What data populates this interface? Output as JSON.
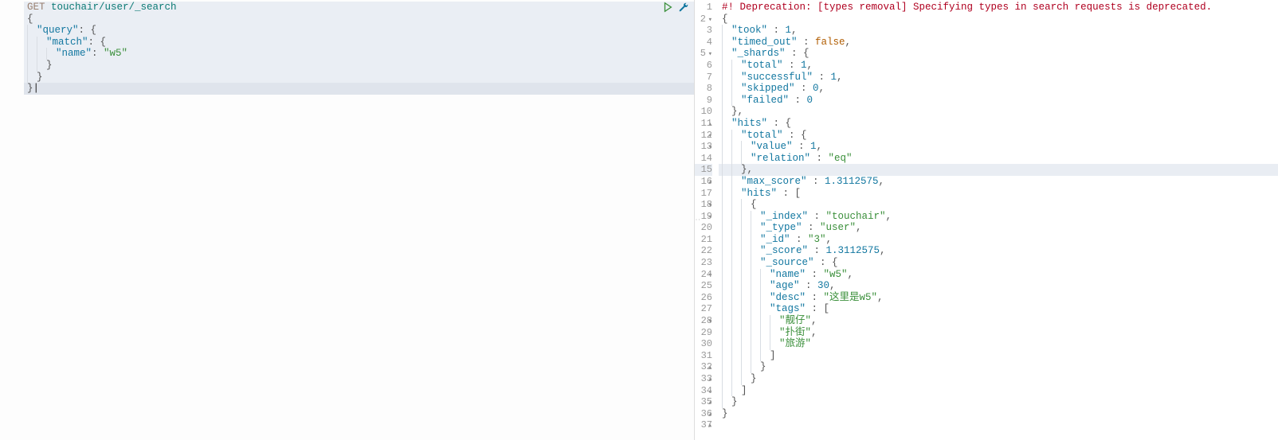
{
  "request": {
    "method": "GET",
    "path": "touchair/user/_search",
    "lines": [
      {
        "indent": 0,
        "text": "{"
      },
      {
        "indent": 1,
        "segs": [
          {
            "t": "key",
            "v": "\"query\""
          },
          {
            "t": "punct",
            "v": ": {"
          }
        ]
      },
      {
        "indent": 2,
        "segs": [
          {
            "t": "key",
            "v": "\"match\""
          },
          {
            "t": "punct",
            "v": ": {"
          }
        ]
      },
      {
        "indent": 3,
        "segs": [
          {
            "t": "key",
            "v": "\"name\""
          },
          {
            "t": "punct",
            "v": ": "
          },
          {
            "t": "str",
            "v": "\"w5\""
          }
        ]
      },
      {
        "indent": 2,
        "text": "}"
      },
      {
        "indent": 1,
        "text": "}"
      },
      {
        "indent": 0,
        "text": "}",
        "cursor": true
      }
    ]
  },
  "response": {
    "lines": [
      {
        "n": 1,
        "segs": [
          {
            "t": "err",
            "v": "#! Deprecation: [types removal] Specifying types in search requests is deprecated."
          }
        ]
      },
      {
        "n": 2,
        "fold": "▾",
        "segs": [
          {
            "t": "punct",
            "v": "{"
          }
        ]
      },
      {
        "n": 3,
        "indent": 1,
        "segs": [
          {
            "t": "key",
            "v": "\"took\""
          },
          {
            "t": "punct",
            "v": " : "
          },
          {
            "t": "num",
            "v": "1"
          },
          {
            "t": "punct",
            "v": ","
          }
        ]
      },
      {
        "n": 4,
        "indent": 1,
        "segs": [
          {
            "t": "key",
            "v": "\"timed_out\""
          },
          {
            "t": "punct",
            "v": " : "
          },
          {
            "t": "bool",
            "v": "false"
          },
          {
            "t": "punct",
            "v": ","
          }
        ]
      },
      {
        "n": 5,
        "fold": "▾",
        "indent": 1,
        "segs": [
          {
            "t": "key",
            "v": "\"_shards\""
          },
          {
            "t": "punct",
            "v": " : {"
          }
        ]
      },
      {
        "n": 6,
        "indent": 2,
        "segs": [
          {
            "t": "key",
            "v": "\"total\""
          },
          {
            "t": "punct",
            "v": " : "
          },
          {
            "t": "num",
            "v": "1"
          },
          {
            "t": "punct",
            "v": ","
          }
        ]
      },
      {
        "n": 7,
        "indent": 2,
        "segs": [
          {
            "t": "key",
            "v": "\"successful\""
          },
          {
            "t": "punct",
            "v": " : "
          },
          {
            "t": "num",
            "v": "1"
          },
          {
            "t": "punct",
            "v": ","
          }
        ]
      },
      {
        "n": 8,
        "indent": 2,
        "segs": [
          {
            "t": "key",
            "v": "\"skipped\""
          },
          {
            "t": "punct",
            "v": " : "
          },
          {
            "t": "num",
            "v": "0"
          },
          {
            "t": "punct",
            "v": ","
          }
        ]
      },
      {
        "n": 9,
        "indent": 2,
        "segs": [
          {
            "t": "key",
            "v": "\"failed\""
          },
          {
            "t": "punct",
            "v": " : "
          },
          {
            "t": "num",
            "v": "0"
          }
        ]
      },
      {
        "n": 10,
        "fold": "▴",
        "indent": 1,
        "segs": [
          {
            "t": "punct",
            "v": "},"
          }
        ]
      },
      {
        "n": 11,
        "fold": "▾",
        "indent": 1,
        "segs": [
          {
            "t": "key",
            "v": "\"hits\""
          },
          {
            "t": "punct",
            "v": " : {"
          }
        ]
      },
      {
        "n": 12,
        "fold": "▾",
        "indent": 2,
        "segs": [
          {
            "t": "key",
            "v": "\"total\""
          },
          {
            "t": "punct",
            "v": " : {"
          }
        ]
      },
      {
        "n": 13,
        "indent": 3,
        "segs": [
          {
            "t": "key",
            "v": "\"value\""
          },
          {
            "t": "punct",
            "v": " : "
          },
          {
            "t": "num",
            "v": "1"
          },
          {
            "t": "punct",
            "v": ","
          }
        ]
      },
      {
        "n": 14,
        "indent": 3,
        "segs": [
          {
            "t": "key",
            "v": "\"relation\""
          },
          {
            "t": "punct",
            "v": " : "
          },
          {
            "t": "str",
            "v": "\"eq\""
          }
        ]
      },
      {
        "n": 15,
        "fold": "▴",
        "indent": 2,
        "current": true,
        "segs": [
          {
            "t": "punct",
            "v": "},"
          }
        ]
      },
      {
        "n": 16,
        "indent": 2,
        "segs": [
          {
            "t": "key",
            "v": "\"max_score\""
          },
          {
            "t": "punct",
            "v": " : "
          },
          {
            "t": "num",
            "v": "1.3112575"
          },
          {
            "t": "punct",
            "v": ","
          }
        ]
      },
      {
        "n": 17,
        "fold": "▾",
        "indent": 2,
        "segs": [
          {
            "t": "key",
            "v": "\"hits\""
          },
          {
            "t": "punct",
            "v": " : ["
          }
        ]
      },
      {
        "n": 18,
        "fold": "▾",
        "indent": 3,
        "segs": [
          {
            "t": "punct",
            "v": "{"
          }
        ]
      },
      {
        "n": 19,
        "indent": 4,
        "segs": [
          {
            "t": "key",
            "v": "\"_index\""
          },
          {
            "t": "punct",
            "v": " : "
          },
          {
            "t": "str",
            "v": "\"touchair\""
          },
          {
            "t": "punct",
            "v": ","
          }
        ]
      },
      {
        "n": 20,
        "indent": 4,
        "segs": [
          {
            "t": "key",
            "v": "\"_type\""
          },
          {
            "t": "punct",
            "v": " : "
          },
          {
            "t": "str",
            "v": "\"user\""
          },
          {
            "t": "punct",
            "v": ","
          }
        ]
      },
      {
        "n": 21,
        "indent": 4,
        "segs": [
          {
            "t": "key",
            "v": "\"_id\""
          },
          {
            "t": "punct",
            "v": " : "
          },
          {
            "t": "str",
            "v": "\"3\""
          },
          {
            "t": "punct",
            "v": ","
          }
        ]
      },
      {
        "n": 22,
        "indent": 4,
        "segs": [
          {
            "t": "key",
            "v": "\"_score\""
          },
          {
            "t": "punct",
            "v": " : "
          },
          {
            "t": "num",
            "v": "1.3112575"
          },
          {
            "t": "punct",
            "v": ","
          }
        ]
      },
      {
        "n": 23,
        "fold": "▾",
        "indent": 4,
        "segs": [
          {
            "t": "key",
            "v": "\"_source\""
          },
          {
            "t": "punct",
            "v": " : {"
          }
        ]
      },
      {
        "n": 24,
        "indent": 5,
        "segs": [
          {
            "t": "key",
            "v": "\"name\""
          },
          {
            "t": "punct",
            "v": " : "
          },
          {
            "t": "str",
            "v": "\"w5\""
          },
          {
            "t": "punct",
            "v": ","
          }
        ]
      },
      {
        "n": 25,
        "indent": 5,
        "segs": [
          {
            "t": "key",
            "v": "\"age\""
          },
          {
            "t": "punct",
            "v": " : "
          },
          {
            "t": "num",
            "v": "30"
          },
          {
            "t": "punct",
            "v": ","
          }
        ]
      },
      {
        "n": 26,
        "indent": 5,
        "segs": [
          {
            "t": "key",
            "v": "\"desc\""
          },
          {
            "t": "punct",
            "v": " : "
          },
          {
            "t": "str",
            "v": "\"这里是w5\""
          },
          {
            "t": "punct",
            "v": ","
          }
        ]
      },
      {
        "n": 27,
        "fold": "▾",
        "indent": 5,
        "segs": [
          {
            "t": "key",
            "v": "\"tags\""
          },
          {
            "t": "punct",
            "v": " : ["
          }
        ]
      },
      {
        "n": 28,
        "indent": 6,
        "segs": [
          {
            "t": "str",
            "v": "\"靓仔\""
          },
          {
            "t": "punct",
            "v": ","
          }
        ]
      },
      {
        "n": 29,
        "indent": 6,
        "segs": [
          {
            "t": "str",
            "v": "\"扑街\""
          },
          {
            "t": "punct",
            "v": ","
          }
        ]
      },
      {
        "n": 30,
        "indent": 6,
        "segs": [
          {
            "t": "str",
            "v": "\"旅游\""
          }
        ]
      },
      {
        "n": 31,
        "fold": "▴",
        "indent": 5,
        "segs": [
          {
            "t": "punct",
            "v": "]"
          }
        ]
      },
      {
        "n": 32,
        "fold": "▴",
        "indent": 4,
        "segs": [
          {
            "t": "punct",
            "v": "}"
          }
        ]
      },
      {
        "n": 33,
        "fold": "▴",
        "indent": 3,
        "segs": [
          {
            "t": "punct",
            "v": "}"
          }
        ]
      },
      {
        "n": 34,
        "fold": "▴",
        "indent": 2,
        "segs": [
          {
            "t": "punct",
            "v": "]"
          }
        ]
      },
      {
        "n": 35,
        "fold": "▴",
        "indent": 1,
        "segs": [
          {
            "t": "punct",
            "v": "}"
          }
        ]
      },
      {
        "n": 36,
        "fold": "▴",
        "indent": 0,
        "segs": [
          {
            "t": "punct",
            "v": "}"
          }
        ]
      },
      {
        "n": 37,
        "segs": []
      }
    ]
  }
}
